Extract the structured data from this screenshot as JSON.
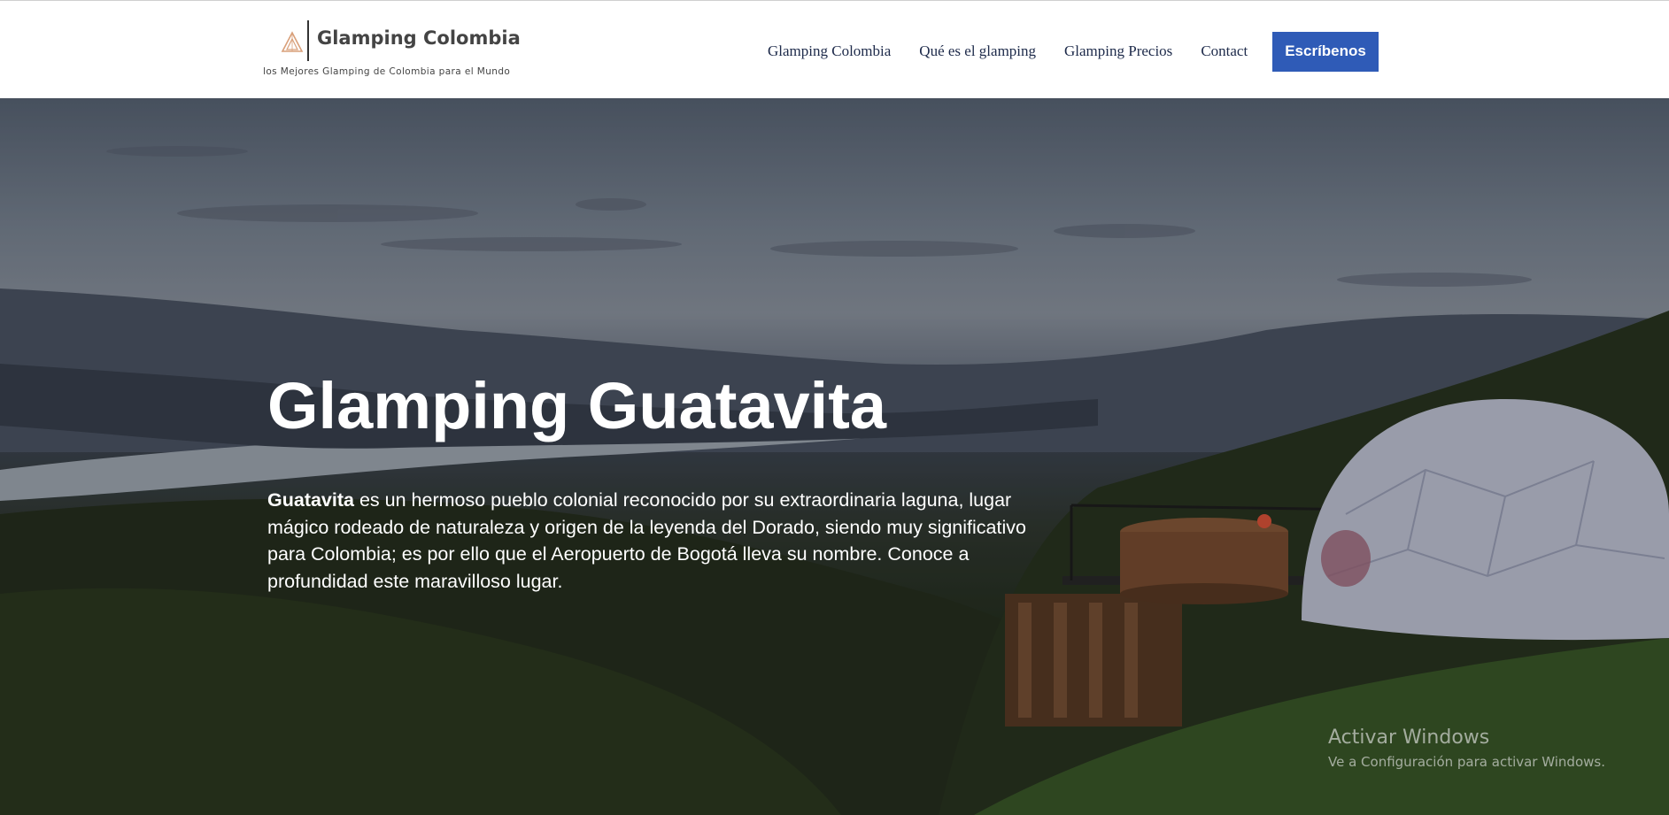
{
  "brand": {
    "name": "Glamping Colombia",
    "tagline": "los Mejores Glamping de Colombia para el Mundo",
    "logo_icon": "tent-triangle-icon",
    "logo_color": "#d9a07a"
  },
  "nav": {
    "items": [
      {
        "label": "Glamping Colombia"
      },
      {
        "label": "Qué es el glamping"
      },
      {
        "label": "Glamping Precios"
      },
      {
        "label": "Contact"
      }
    ],
    "cta_label": "Escríbenos",
    "cta_color": "#2f5bb7"
  },
  "hero": {
    "title": "Glamping Guatavita",
    "intro_bold": "Guatavita",
    "intro_rest": " es un hermoso pueblo colonial reconocido por su extraordinaria laguna, lugar mágico rodeado de naturaleza y origen de la leyenda del Dorado, siendo muy significativo para Colombia; es por ello que el Aeropuerto de Bogotá lleva su nombre. Conoce a profundidad este maravilloso lugar."
  },
  "watermark": {
    "title": "Activar Windows",
    "subtitle": "Ve a Configuración para activar Windows."
  }
}
